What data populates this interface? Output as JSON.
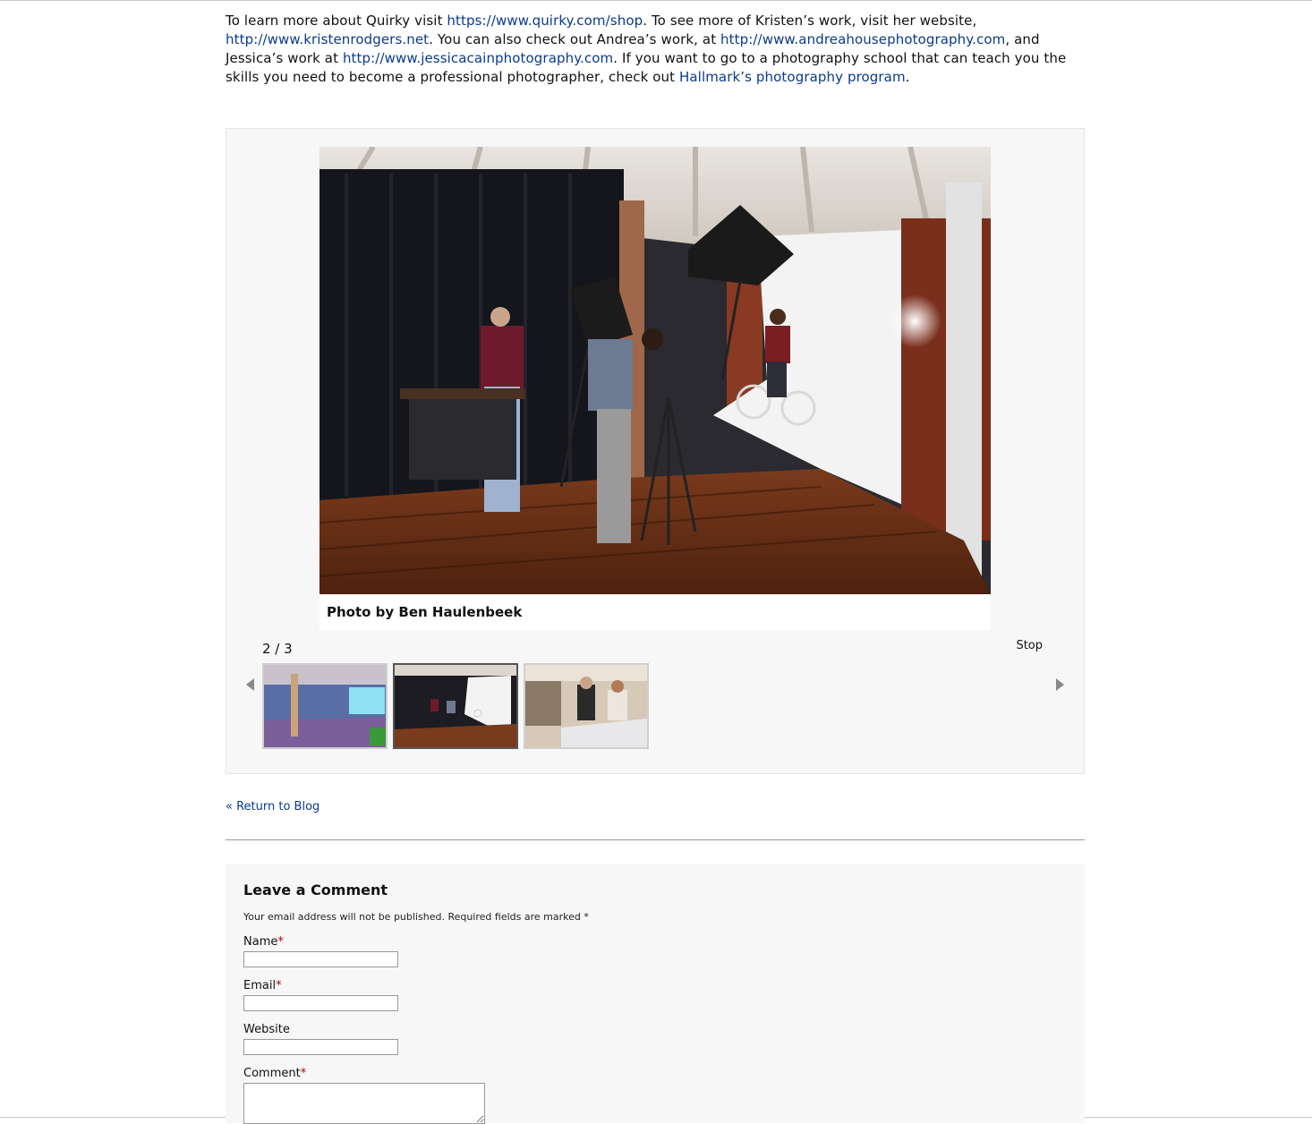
{
  "intro": {
    "t1": "To learn more about Quirky visit ",
    "link_quirky": "https://www.quirky.com/shop",
    "t2": ". To see more of Kristen’s work, visit her website, ",
    "link_kristen": "http://www.kristenrodgers.net",
    "t3": ". You can also check out Andrea’s work, at ",
    "link_andrea": "http://www.andreahousephotography.com",
    "t4": ", and Jessica’s work at ",
    "link_jessica": "http://www.jessicacainphotography.com",
    "t5": ". If you want to go to a photography school that can teach you the skills you need to become a professional photographer, check out ",
    "link_hallmark": "Hallmark’s photography program",
    "t6": "."
  },
  "gallery": {
    "caption": "Photo by Ben Haulenbeek",
    "counter": "2 / 3",
    "stop_label": "Stop",
    "current_index": 2,
    "total": 3,
    "thumbnails": [
      "studio-interior-thumbnail",
      "photo-shoot-thumbnail",
      "workshop-thumbnail"
    ]
  },
  "nav": {
    "return_label": "« Return to Blog"
  },
  "comment_form": {
    "title": "Leave a Comment",
    "note": "Your email address will not be published. Required fields are marked *",
    "name_label": "Name",
    "email_label": "Email",
    "website_label": "Website",
    "comment_label": "Comment",
    "required_mark": "*"
  },
  "colors": {
    "link": "#0b3a8c",
    "required": "#b00000",
    "panel_bg": "#f7f7f7"
  }
}
